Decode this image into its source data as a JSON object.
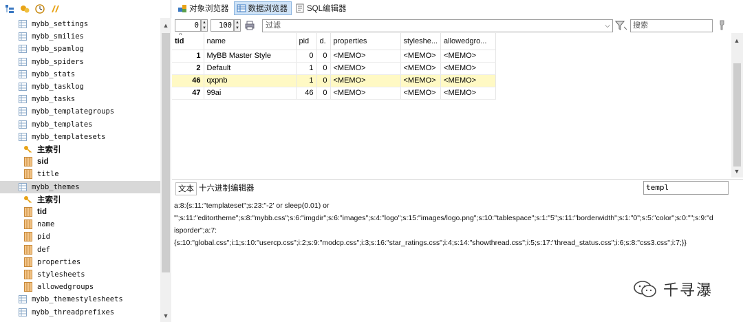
{
  "tree": {
    "items": [
      {
        "label": "mybb_settings",
        "icon": "table-icon",
        "level": 1
      },
      {
        "label": "mybb_smilies",
        "icon": "table-icon",
        "level": 1
      },
      {
        "label": "mybb_spamlog",
        "icon": "table-icon",
        "level": 1
      },
      {
        "label": "mybb_spiders",
        "icon": "table-icon",
        "level": 1
      },
      {
        "label": "mybb_stats",
        "icon": "table-icon",
        "level": 1
      },
      {
        "label": "mybb_tasklog",
        "icon": "table-icon",
        "level": 1
      },
      {
        "label": "mybb_tasks",
        "icon": "table-icon",
        "level": 1
      },
      {
        "label": "mybb_templategroups",
        "icon": "table-icon",
        "level": 1
      },
      {
        "label": "mybb_templates",
        "icon": "table-icon",
        "level": 1
      },
      {
        "label": "mybb_templatesets",
        "icon": "table-icon",
        "level": 1
      },
      {
        "label": "主索引",
        "icon": "key-icon",
        "level": 2
      },
      {
        "label": "sid",
        "icon": "column-icon",
        "level": 2,
        "bold": true
      },
      {
        "label": "title",
        "icon": "column-icon",
        "level": 2
      },
      {
        "label": "mybb_themes",
        "icon": "table-icon",
        "level": 1,
        "selected": true
      },
      {
        "label": "主索引",
        "icon": "key-icon",
        "level": 2
      },
      {
        "label": "tid",
        "icon": "column-icon",
        "level": 2,
        "bold": true
      },
      {
        "label": "name",
        "icon": "column-icon",
        "level": 2
      },
      {
        "label": "pid",
        "icon": "column-icon",
        "level": 2
      },
      {
        "label": "def",
        "icon": "column-icon",
        "level": 2
      },
      {
        "label": "properties",
        "icon": "column-icon",
        "level": 2
      },
      {
        "label": "stylesheets",
        "icon": "column-icon",
        "level": 2
      },
      {
        "label": "allowedgroups",
        "icon": "column-icon",
        "level": 2
      },
      {
        "label": "mybb_themestylesheets",
        "icon": "table-icon",
        "level": 1
      },
      {
        "label": "mybb_threadprefixes",
        "icon": "table-icon",
        "level": 1
      }
    ]
  },
  "tabs": [
    {
      "label": "对象浏览器",
      "icon": "object-browser-icon"
    },
    {
      "label": "数据浏览器",
      "icon": "data-browser-icon",
      "active": true
    },
    {
      "label": "SQL编辑器",
      "icon": "sql-editor-icon"
    }
  ],
  "toolbar": {
    "offset": "0",
    "limit": "100",
    "filter_placeholder": "过滤",
    "search_placeholder": "搜索"
  },
  "grid": {
    "columns": [
      "tid",
      "name",
      "pid",
      "d.",
      "properties",
      "styleshe...",
      "allowedgro..."
    ],
    "rows": [
      {
        "tid": "1",
        "name": "MyBB Master Style",
        "pid": "0",
        "d": "0",
        "properties": "<MEMO>",
        "stylesheets": "<MEMO>",
        "allowedgroups": "<MEMO>"
      },
      {
        "tid": "2",
        "name": "Default",
        "pid": "1",
        "d": "0",
        "properties": "<MEMO>",
        "stylesheets": "<MEMO>",
        "allowedgroups": "<MEMO>"
      },
      {
        "tid": "46",
        "name": "qxpnb",
        "pid": "1",
        "d": "0",
        "properties": "<MEMO>",
        "stylesheets": "<MEMO>",
        "allowedgroups": "<MEMO>",
        "highlighted": true
      },
      {
        "tid": "47",
        "name": "99ai",
        "pid": "46",
        "d": "0",
        "properties": "<MEMO>",
        "stylesheets": "<MEMO>",
        "allowedgroups": "<MEMO>"
      }
    ]
  },
  "editor": {
    "tabs": [
      "文本",
      "十六进制编辑器"
    ],
    "search_value": "templ",
    "lines": [
      "a:8:{s:11:\"templateset\";s:23:\"-2' or sleep(0.01) or",
      "'\";s:11:\"editortheme\";s:8:\"mybb.css\";s:6:\"imgdir\";s:6:\"images\";s:4:\"logo\";s:15:\"images/logo.png\";s:10:\"tablespace\";s:1:\"5\";s:11:\"borderwidth\";s:1:\"0\";s:5:\"color\";s:0:\"\";s:9:\"d",
      "isporder\";a:7:",
      "{s:10:\"global.css\";i:1;s:10:\"usercp.css\";i:2;s:9:\"modcp.css\";i:3;s:16:\"star_ratings.css\";i:4;s:14:\"showthread.css\";i:5;s:17:\"thread_status.css\";i:6;s:8:\"css3.css\";i:7;}}"
    ]
  },
  "watermark": {
    "text": "千寻瀑"
  },
  "colors": {
    "highlight_row": "#fff9c4",
    "active_tab": "#cfe3f7",
    "selected_tree": "#d8d8d8"
  }
}
